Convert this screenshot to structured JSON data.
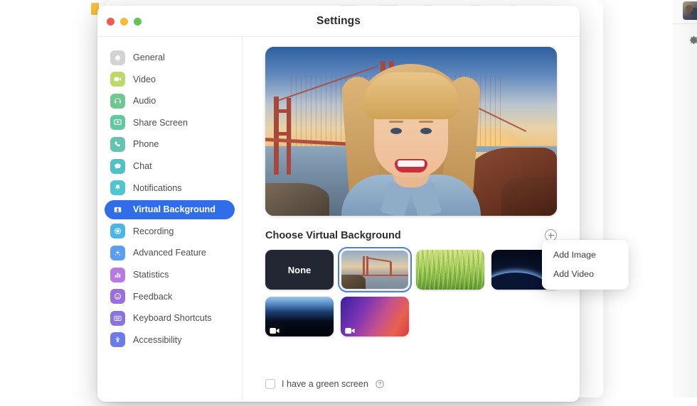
{
  "background_window": {
    "name": "zoom-main-window",
    "gear_icon": "gear-icon",
    "avatar": "user-avatar-thumbnail"
  },
  "settings_window": {
    "title": "Settings",
    "traffic_lights": [
      {
        "name": "close-button",
        "color": "#f05b51"
      },
      {
        "name": "minimize-button",
        "color": "#f5bb3b"
      },
      {
        "name": "maximize-button",
        "color": "#5ec654"
      }
    ]
  },
  "sidebar": {
    "items": [
      {
        "label": "General",
        "icon": "gear-icon",
        "color": "#d3d3d3",
        "active": false
      },
      {
        "label": "Video",
        "icon": "video-camera-icon",
        "color": "#bcd96a",
        "active": false
      },
      {
        "label": "Audio",
        "icon": "headphones-icon",
        "color": "#6dc98f",
        "active": false
      },
      {
        "label": "Share Screen",
        "icon": "share-screen-icon",
        "color": "#63c7a2",
        "active": false
      },
      {
        "label": "Phone",
        "icon": "phone-icon",
        "color": "#63c4b2",
        "active": false
      },
      {
        "label": "Chat",
        "icon": "chat-bubble-icon",
        "color": "#4ec2c6",
        "active": false
      },
      {
        "label": "Notifications",
        "icon": "bell-icon",
        "color": "#4ec6cf",
        "active": false
      },
      {
        "label": "Virtual Background",
        "icon": "person-badge-icon",
        "color": "#2f6ee8",
        "active": true
      },
      {
        "label": "Recording",
        "icon": "record-circle-icon",
        "color": "#48b6e8",
        "active": false
      },
      {
        "label": "Advanced Feature",
        "icon": "sparkle-icon",
        "color": "#5b9ef0",
        "active": false
      },
      {
        "label": "Statistics",
        "icon": "bar-chart-icon",
        "color": "#b77ae0",
        "active": false
      },
      {
        "label": "Feedback",
        "icon": "smiley-face-icon",
        "color": "#9b6ee0",
        "active": false
      },
      {
        "label": "Keyboard Shortcuts",
        "icon": "keyboard-icon",
        "color": "#8b73e2",
        "active": false
      },
      {
        "label": "Accessibility",
        "icon": "accessibility-icon",
        "color": "#6d7be6",
        "active": false
      }
    ],
    "active_accent": "#2f6ee8"
  },
  "content": {
    "preview": {
      "name": "video-preview",
      "description": "Webcam preview with Golden Gate Bridge sunset virtual background"
    },
    "choose_title": "Choose Virtual Background",
    "add_button_icon": "plus-circle-icon",
    "thumbnails": [
      {
        "name": "background-none",
        "label": "None",
        "kind": "none",
        "selected": false,
        "video": false
      },
      {
        "name": "background-bridge",
        "label": "",
        "kind": "bridge",
        "selected": true,
        "video": false
      },
      {
        "name": "background-grass",
        "label": "",
        "kind": "grass",
        "selected": false,
        "video": false
      },
      {
        "name": "background-earth",
        "label": "",
        "kind": "earth",
        "selected": false,
        "video": false
      },
      {
        "name": "background-horizon",
        "label": "",
        "kind": "horizon",
        "selected": false,
        "video": true
      },
      {
        "name": "background-gradient",
        "label": "",
        "kind": "gradient",
        "selected": false,
        "video": true
      }
    ],
    "video_badge_icon": "video-camera-badge-icon"
  },
  "dropdown": {
    "visible": true,
    "items": [
      {
        "label": "Add Image",
        "name": "menu-item-add-image"
      },
      {
        "label": "Add Video",
        "name": "menu-item-add-video"
      }
    ]
  },
  "footer": {
    "checkbox_label": "I have a green screen",
    "checked": false,
    "help_icon": "question-mark-circle-icon"
  }
}
